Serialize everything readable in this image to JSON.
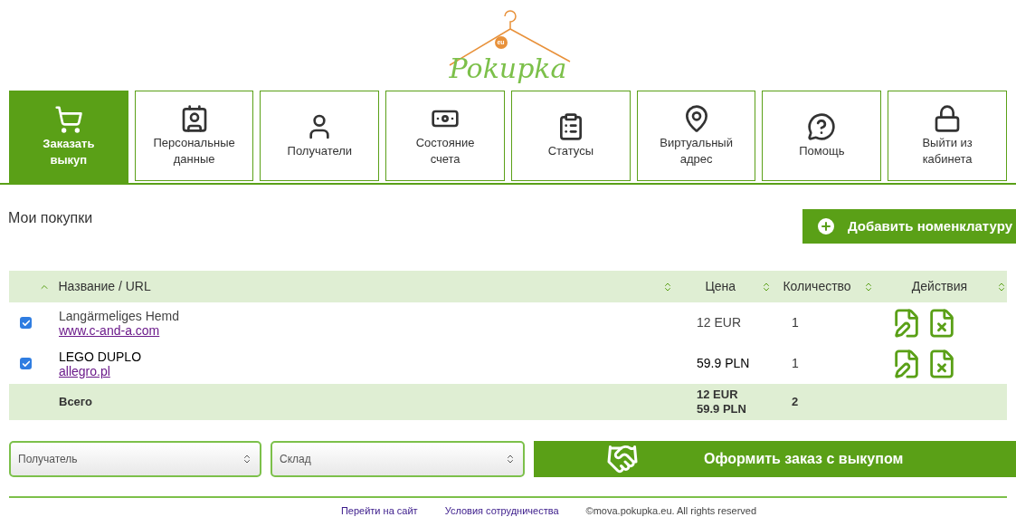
{
  "logo": {
    "text": "Pokupka",
    "badge": "eu"
  },
  "nav": [
    {
      "label": "Заказать выкуп",
      "selected": true
    },
    {
      "label": "Персональные данные",
      "selected": false
    },
    {
      "label": "Получатели",
      "selected": false
    },
    {
      "label": "Состояние счета",
      "selected": false
    },
    {
      "label": "Статусы",
      "selected": false
    },
    {
      "label": "Виртуальный адрес",
      "selected": false
    },
    {
      "label": "Помощь",
      "selected": false
    },
    {
      "label": "Выйти из кабинета",
      "selected": false
    }
  ],
  "section_title": "Мои покупки",
  "add_button": "Добавить номенклатуру",
  "table": {
    "columns": [
      "Название / URL",
      "Цена",
      "Количество",
      "Действия"
    ],
    "rows": [
      {
        "checked": true,
        "name": "Langärmeliges Hemd",
        "url": "www.c-and-a.com",
        "price": "12 EUR",
        "quantity": "1",
        "bold_price": false
      },
      {
        "checked": true,
        "name": "LEGO DUPLO",
        "url": "allegro.pl",
        "price": "59.9 PLN",
        "quantity": "1",
        "bold_price": true
      }
    ],
    "total": {
      "label": "Всего",
      "prices": [
        "12 EUR",
        "59.9 PLN"
      ],
      "quantity": "2"
    }
  },
  "recipient_select": {
    "placeholder": "Получатель"
  },
  "warehouse_select": {
    "placeholder": "Склад"
  },
  "order_button": "Оформить заказ с выкупом",
  "footer": {
    "links": [
      "Перейти на сайт",
      "Условия сотрудничества"
    ],
    "copyright": "©mova.pokupka.eu. All rights reserved"
  }
}
